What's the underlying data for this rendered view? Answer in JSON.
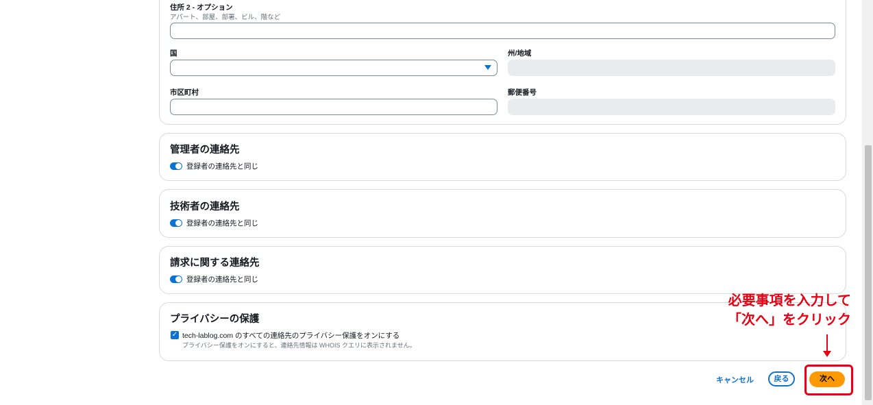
{
  "address_card": {
    "address2_label": "住所 2 - オプション",
    "address2_hint": "アパート、部屋、部署、ビル、階など",
    "address2_value": "",
    "country_label": "国",
    "country_value": "",
    "state_label": "州/地域",
    "city_label": "市区町村",
    "city_value": "",
    "postal_label": "郵便番号"
  },
  "admin_contact": {
    "title": "管理者の連絡先",
    "toggle_label": "登録者の連絡先と同じ",
    "toggle_on": true
  },
  "tech_contact": {
    "title": "技術者の連絡先",
    "toggle_label": "登録者の連絡先と同じ",
    "toggle_on": true
  },
  "billing_contact": {
    "title": "請求に関する連絡先",
    "toggle_label": "登録者の連絡先と同じ",
    "toggle_on": true
  },
  "privacy": {
    "title": "プライバシーの保護",
    "checkbox_label": "tech-lablog.com のすべての連絡先のプライバシー保護をオンにする",
    "checkbox_desc": "プライバシー保護をオンにすると、連絡先情報は WHOIS クエリに表示されません。",
    "checked": true
  },
  "actions": {
    "cancel": "キャンセル",
    "back": "戻る",
    "next": "次へ"
  },
  "annotation": {
    "line1": "必要事項を入力して",
    "line2": "「次へ」をクリック"
  },
  "colors": {
    "accent": "#0972d3",
    "primary_button": "#ff9900",
    "annotation": "#e60012"
  }
}
